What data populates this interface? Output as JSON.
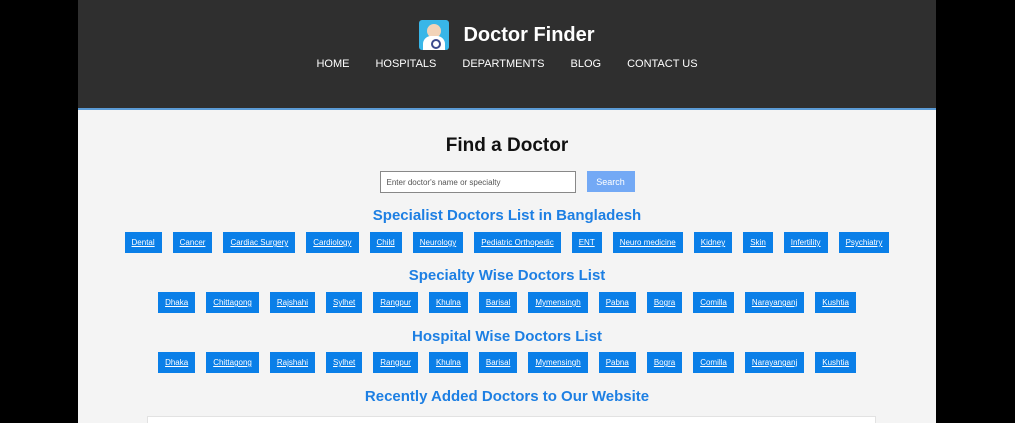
{
  "header": {
    "title": "Doctor Finder",
    "logo_icon": "doctor-avatar-icon",
    "nav": [
      "HOME",
      "HOSPITALS",
      "DEPARTMENTS",
      "BLOG",
      "CONTACT US"
    ]
  },
  "main": {
    "title": "Find a Doctor",
    "search": {
      "placeholder": "Enter doctor's name or specialty",
      "button_label": "Search"
    },
    "specialist": {
      "title": "Specialist Doctors List in Bangladesh",
      "items": [
        "Dental",
        "Cancer",
        "Cardiac Surgery",
        "Cardiology",
        "Child",
        "Neurology",
        "Pediatric Orthopedic",
        "ENT",
        "Neuro medicine",
        "Kidney",
        "Skin",
        "Infertility",
        "Psychiatry"
      ]
    },
    "specialty_wise": {
      "title": "Specialty Wise Doctors List",
      "items": [
        "Dhaka",
        "Chittagong",
        "Rajshahi",
        "Sylhet",
        "Rangpur",
        "Khulna",
        "Barisal",
        "Mymensingh",
        "Pabna",
        "Bogra",
        "Comilla",
        "Narayanganj",
        "Kushtia"
      ]
    },
    "hospital_wise": {
      "title": "Hospital Wise Doctors List",
      "items": [
        "Dhaka",
        "Chittagong",
        "Rajshahi",
        "Sylhet",
        "Rangpur",
        "Khulna",
        "Barisal",
        "Mymensingh",
        "Pabna",
        "Bogra",
        "Comilla",
        "Narayanganj",
        "Kushtia"
      ]
    },
    "recent": {
      "title": "Recently Added Doctors to Our Website"
    }
  },
  "colors": {
    "header_bg": "#2f2f2f",
    "accent": "#1d7fe3",
    "tag_bg": "#0a7fe8",
    "search_button": "#73a9f5"
  }
}
